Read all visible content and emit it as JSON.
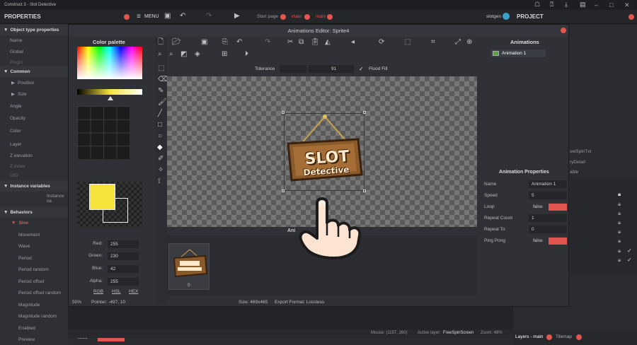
{
  "window": {
    "title": "Construct 3 - Slot Detective"
  },
  "menubar": {
    "properties": "PROPERTIES",
    "menu": "MENU",
    "tab_start": "Start page",
    "tab_main1": "main",
    "tab_main2": "main",
    "user": "slotgen",
    "project": "PROJECT"
  },
  "properties": {
    "object_type_properties": "Object type properties",
    "rows": [
      "Name",
      "Global",
      "Plugin"
    ],
    "common": "Common",
    "common_rows": [
      "Position",
      "Size",
      "Angle",
      "Opacity",
      "Color",
      "Layer",
      "Z elevation",
      "Z index",
      "UID"
    ],
    "instance_variables": "Instance variables",
    "instance_value": "Instance va",
    "behaviors": "Behaviors",
    "sine": "Sine",
    "sine_rows": [
      "Movement",
      "Wave",
      "Period",
      "Period random",
      "Period offset",
      "Period offset random",
      "Magnitude",
      "Magnitude random",
      "Enabled",
      "Preview"
    ],
    "enabled_value": "true",
    "preview_value": "false"
  },
  "dialog": {
    "title": "Animations Editor: Sprite4",
    "tolerance_label": "Tolerance",
    "tolerance_value": "91",
    "flood_fill_label": "Flood Fill"
  },
  "palette": {
    "title": "Color palette",
    "red_label": "Red:",
    "red": "255",
    "green_label": "Green:",
    "green": "230",
    "blue_label": "Blue:",
    "blue": "42",
    "alpha_label": "Alpha:",
    "alpha": "255",
    "rgb": "RGB",
    "hsl": "HSL",
    "hex": "HEX",
    "primary_color": "#f5e23a"
  },
  "status": {
    "zoom": "50%",
    "pointer": "Pointer: -497, 10",
    "size": "Size: 469x465",
    "export": "Export Format: Lossless"
  },
  "frames": {
    "label": "Ani",
    "frame0": "0"
  },
  "sign": {
    "line1": "SLOT",
    "line2": "Detective"
  },
  "animations": {
    "title": "Animations",
    "items": [
      "Animation 1"
    ]
  },
  "anim_props": {
    "title": "Animation Properties",
    "name_label": "Name",
    "name_value": "Animation 1",
    "speed_label": "Speed",
    "speed_value": "5",
    "loop_label": "Loop",
    "loop_value": "false",
    "repeat_count_label": "Repeat Count",
    "repeat_count_value": "1",
    "repeat_to_label": "Repeat To",
    "repeat_to_value": "0",
    "pingpong_label": "Ping Pong",
    "pingpong_value": "false"
  },
  "project_tree": {
    "items": [
      "owSpinTxt",
      "ryDetail",
      "able"
    ]
  },
  "bottom": {
    "mouse": "Mouse: (1157, 260)",
    "active_layer_label": "Active layer:",
    "active_layer": "FreeSpinScreen",
    "zoom": "Zoom: 48%",
    "layers_tab": "Layers - main",
    "tilemap_tab": "Tilemap"
  }
}
